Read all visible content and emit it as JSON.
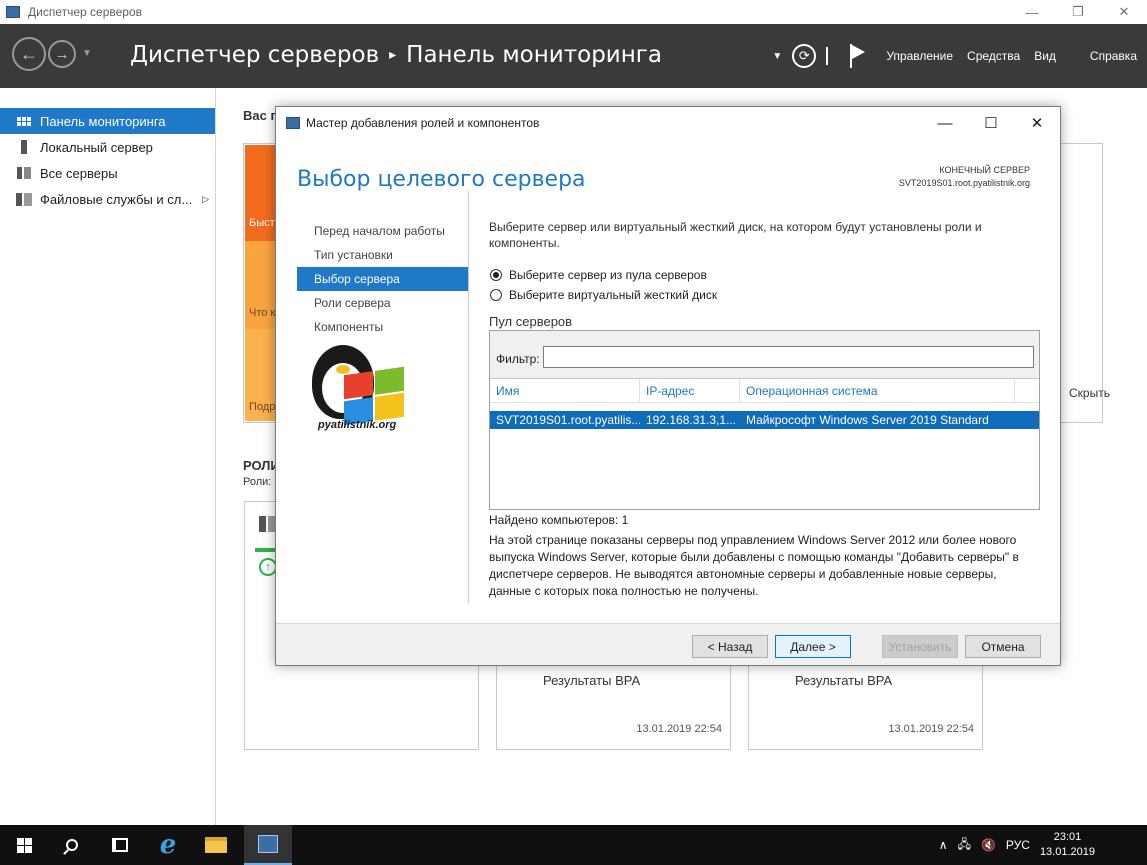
{
  "window": {
    "title": "Диспетчер серверов",
    "minimize": "—",
    "restore": "❐",
    "close": "✕"
  },
  "header": {
    "crumb_root": "Диспетчер серверов",
    "crumb_sep": "▸",
    "crumb_current": "Панель мониторинга",
    "menu": [
      "Управление",
      "Средства",
      "Вид",
      "Справка"
    ]
  },
  "sidebar": {
    "items": [
      {
        "label": "Панель мониторинга",
        "active": true
      },
      {
        "label": "Локальный сервер",
        "active": false
      },
      {
        "label": "Все серверы",
        "active": false
      },
      {
        "label": "Файловые службы и сл...",
        "active": false,
        "arrow": "▷"
      }
    ]
  },
  "background": {
    "welcome_title": "Вас п",
    "quick_start": [
      "Быст",
      "Что к",
      "Подр"
    ],
    "hide_link": "Скрыть",
    "roles_title": "РОЛИ",
    "roles_sub": "Роли:",
    "bpa_tiles": [
      {
        "label": "Результаты BPA",
        "date": "13.01.2019 22:54"
      },
      {
        "label": "Результаты BPA",
        "date": "13.01.2019 22:54"
      }
    ]
  },
  "wizard": {
    "title": "Мастер добавления ролей и компонентов",
    "heading": "Выбор целевого сервера",
    "dest_label": "КОНЕЧНЫЙ СЕРВЕР",
    "dest_value": "SVT2019S01.root.pyatilistnik.org",
    "steps": [
      {
        "label": "Перед началом работы",
        "active": false
      },
      {
        "label": "Тип установки",
        "active": false
      },
      {
        "label": "Выбор сервера",
        "active": true
      },
      {
        "label": "Роли сервера",
        "active": false
      },
      {
        "label": "Компоненты",
        "active": false
      }
    ],
    "logo_text": "pyatilistnik.org",
    "description": "Выберите сервер или виртуальный жесткий диск, на котором будут установлены роли и компоненты.",
    "radio_pool": "Выберите сервер из пула серверов",
    "radio_vhd": "Выберите виртуальный жесткий диск",
    "pool_title": "Пул серверов",
    "filter_label": "Фильтр:",
    "filter_value": "",
    "columns": [
      "Имя",
      "IP-адрес",
      "Операционная система"
    ],
    "rows": [
      {
        "name": "SVT2019S01.root.pyatilis...",
        "ip": "192.168.31.3,1...",
        "os": "Майкрософт Windows Server 2019 Standard"
      }
    ],
    "found": "Найдено компьютеров: 1",
    "note": "На этой странице показаны серверы под управлением Windows Server 2012 или более нового выпуска Windows Server, которые были добавлены с помощью команды \"Добавить серверы\" в диспетчере серверов. Не выводятся автономные серверы и добавленные новые серверы, данные с которых пока полностью не получены.",
    "buttons": {
      "back": "< Назад",
      "next": "Далее >",
      "install": "Установить",
      "cancel": "Отмена"
    }
  },
  "taskbar": {
    "lang": "РУС",
    "time": "23:01",
    "date": "13.01.2019",
    "tray_up": "∧"
  },
  "colors": {
    "accent": "#1f78c8",
    "header_bg": "#3a3a3a",
    "taskbar_bg": "#101010"
  }
}
